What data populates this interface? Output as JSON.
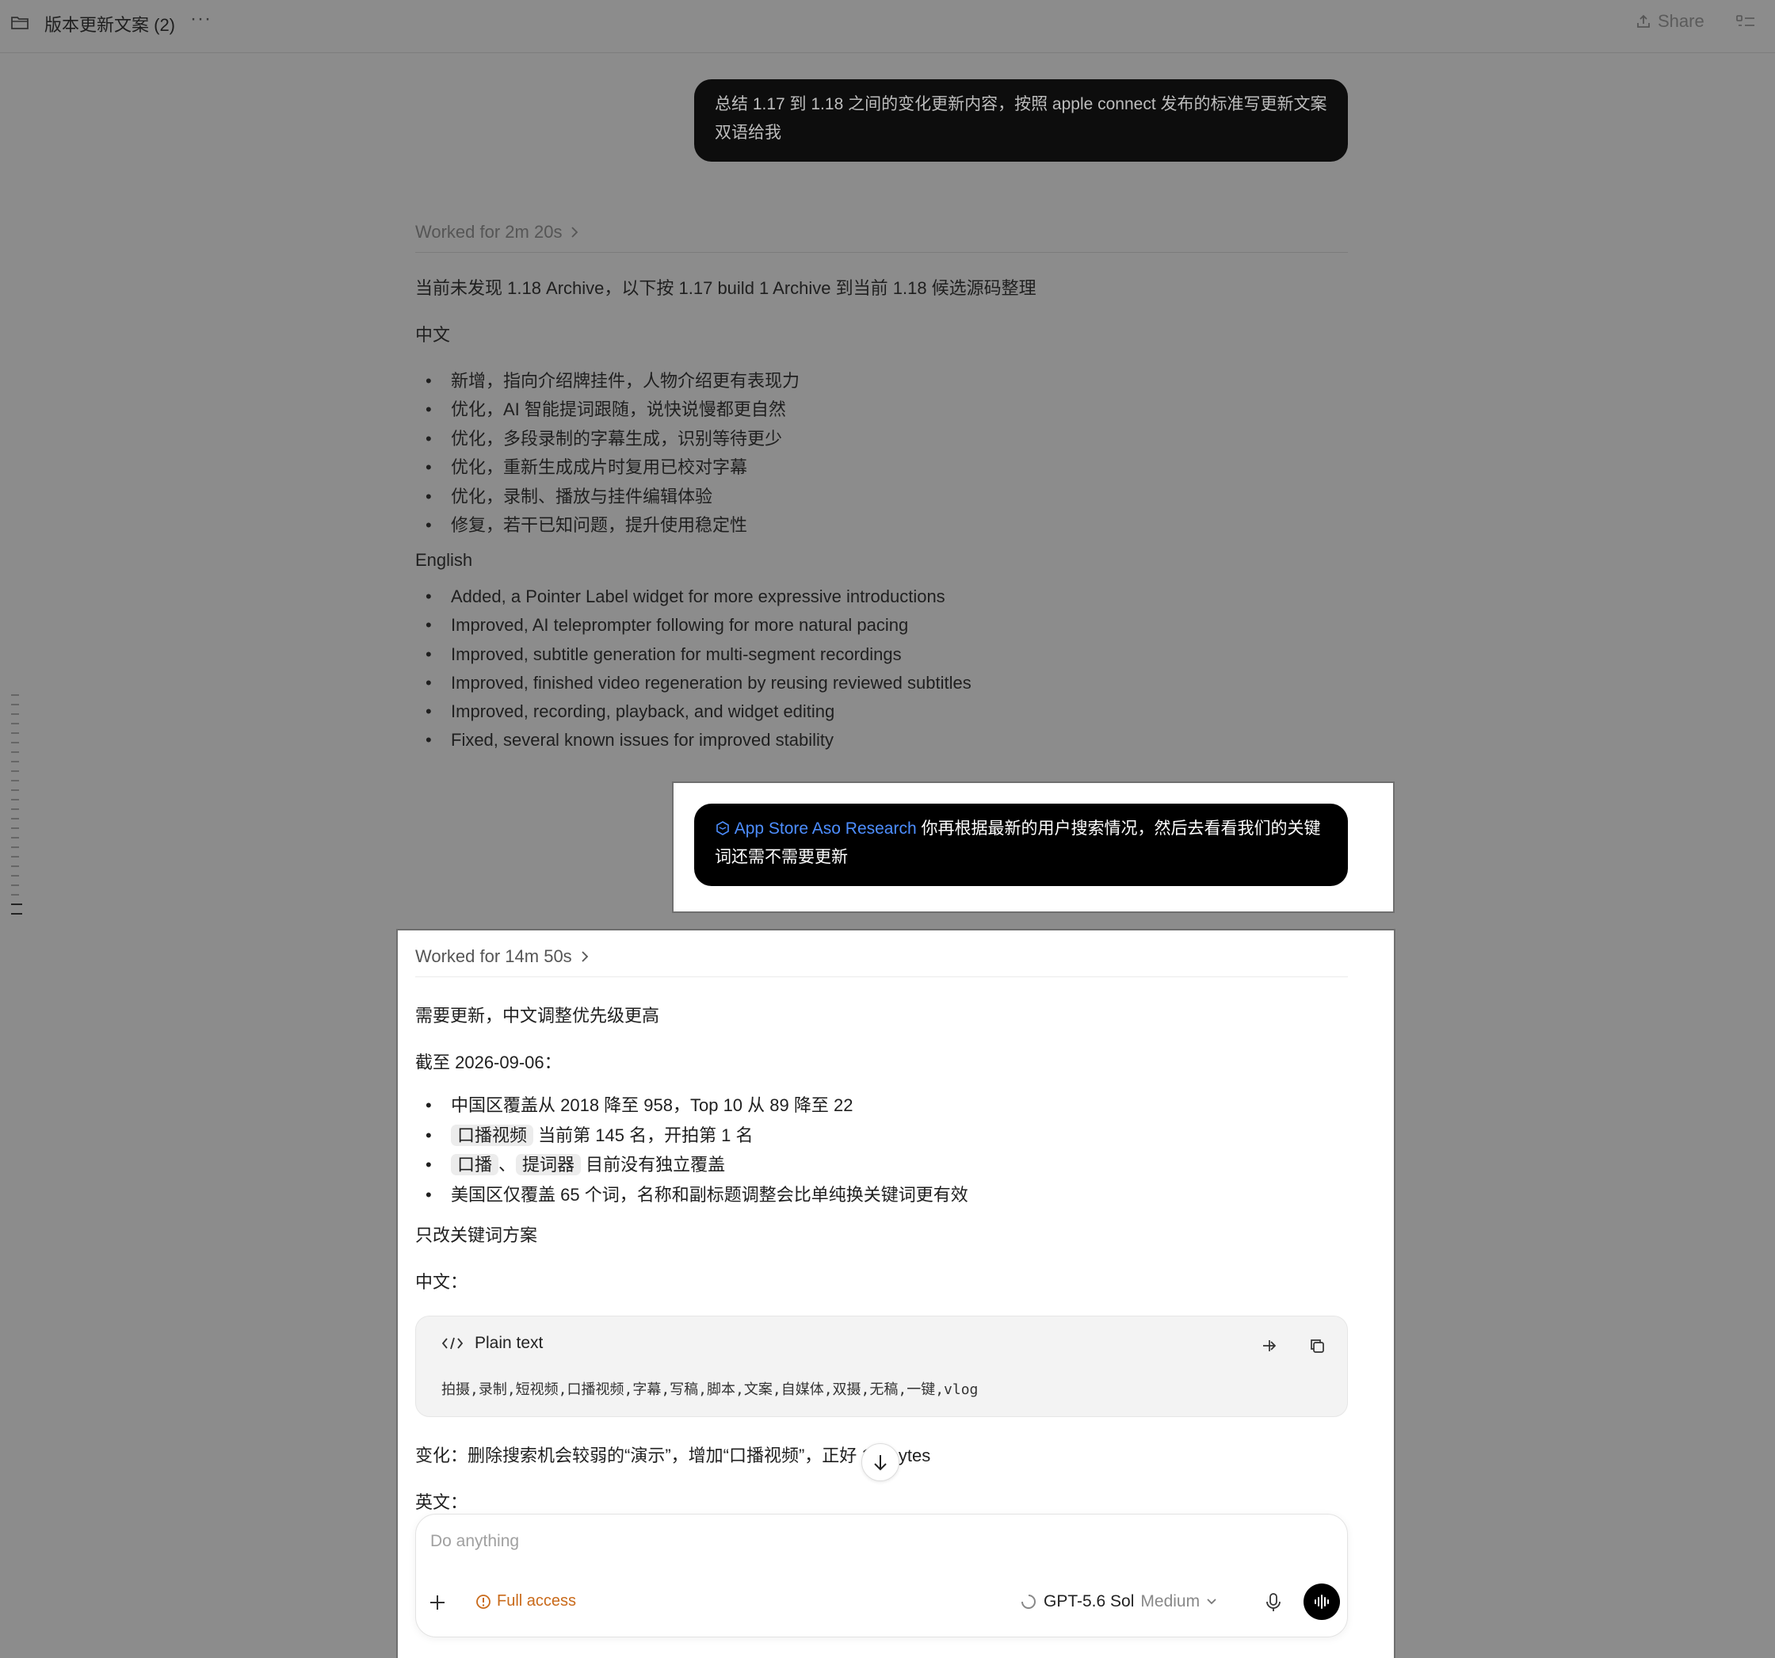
{
  "topbar": {
    "title": "版本更新文案 (2)",
    "more": "···",
    "share": "Share"
  },
  "msg1": {
    "text": "总结 1.17 到 1.18 之间的变化更新内容，按照 apple connect 发布的标准写更新文案双语给我"
  },
  "resp1": {
    "worked": "Worked for 2m 20s",
    "intro": "当前未发现 1.18 Archive，以下按 1.17 build 1 Archive 到当前 1.18 候选源码整理",
    "zh_heading": "中文",
    "zh_items": [
      "新增，指向介绍牌挂件，人物介绍更有表现力",
      "优化，AI 智能提词跟随，说快说慢都更自然",
      "优化，多段录制的字幕生成，识别等待更少",
      "优化，重新生成成片时复用已校对字幕",
      "优化，录制、播放与挂件编辑体验",
      "修复，若干已知问题，提升使用稳定性"
    ],
    "en_heading": "English",
    "en_items": [
      "Added, a Pointer Label widget for more expressive introductions",
      "Improved, AI teleprompter following for more natural pacing",
      "Improved, subtitle generation for multi-segment recordings",
      "Improved, finished video regeneration by reusing reviewed subtitles",
      "Improved, recording, playback, and widget editing",
      "Fixed, several known issues for improved stability"
    ]
  },
  "msg2": {
    "mention": "App Store Aso Research",
    "text": "你再根据最新的用户搜索情况，然后去看看我们的关键词还需不需要更新"
  },
  "resp2": {
    "worked": "Worked for 14m 50s",
    "p1": "需要更新，中文调整优先级更高",
    "p2": "截至 2026-09-06：",
    "b1": "中国区覆盖从 2018 降至 958，Top 10 从 89 降至 22",
    "b2_chip": "口播视频",
    "b2_text": "当前第 145 名，开拍第 1 名",
    "b3_chip1": "口播",
    "b3_sep": "、",
    "b3_chip2": "提词器",
    "b3_text": "目前没有独立覆盖",
    "b4": "美国区仅覆盖 65 个词，名称和副标题调整会比单纯换关键词更有效",
    "p3": "只改关键词方案",
    "p4": "中文：",
    "code_lang": "Plain text",
    "code_text": "拍摄,录制,短视频,口播视频,字幕,写稿,脚本,文案,自媒体,双摄,无稿,一键,vlog",
    "p5a": "变化：删除搜索机会较弱的“演示”，增加“口播视频”，正好 1",
    "p5b": "bytes",
    "p6": "英文："
  },
  "composer": {
    "placeholder": "Do anything",
    "access": "Full access",
    "model": "GPT-5.6 Sol",
    "effort": "Medium"
  },
  "colors": {
    "background": "#8c8c8c",
    "mention": "#4d8eff",
    "access": "#c96a1a"
  }
}
